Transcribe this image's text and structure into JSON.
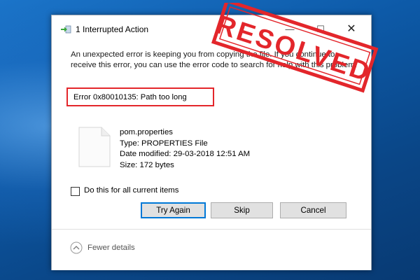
{
  "window": {
    "title": "1 Interrupted Action",
    "minimize_glyph": "—",
    "maximize_glyph": "☐",
    "close_glyph": "✕"
  },
  "message": "An unexpected error is keeping you from copying the file. If you continue to receive this error, you can use the error code to search for help with this problem.",
  "error": "Error 0x80010135: Path too long",
  "file": {
    "icon": "blank-file-icon",
    "name": "pom.properties",
    "type": "Type: PROPERTIES File",
    "modified": "Date modified: 29-03-2018 12:51 AM",
    "size": "Size: 172 bytes"
  },
  "checkbox": {
    "label": "Do this for all current items",
    "checked": false
  },
  "buttons": {
    "try_again": "Try Again",
    "skip": "Skip",
    "cancel": "Cancel"
  },
  "footer": {
    "fewer_details": "Fewer details",
    "icon": "chevron-up-icon"
  },
  "stamp": {
    "text": "RESOLVED",
    "color": "#e3262b"
  },
  "colors": {
    "accent": "#0078d7",
    "highlight": "#e3262b"
  }
}
